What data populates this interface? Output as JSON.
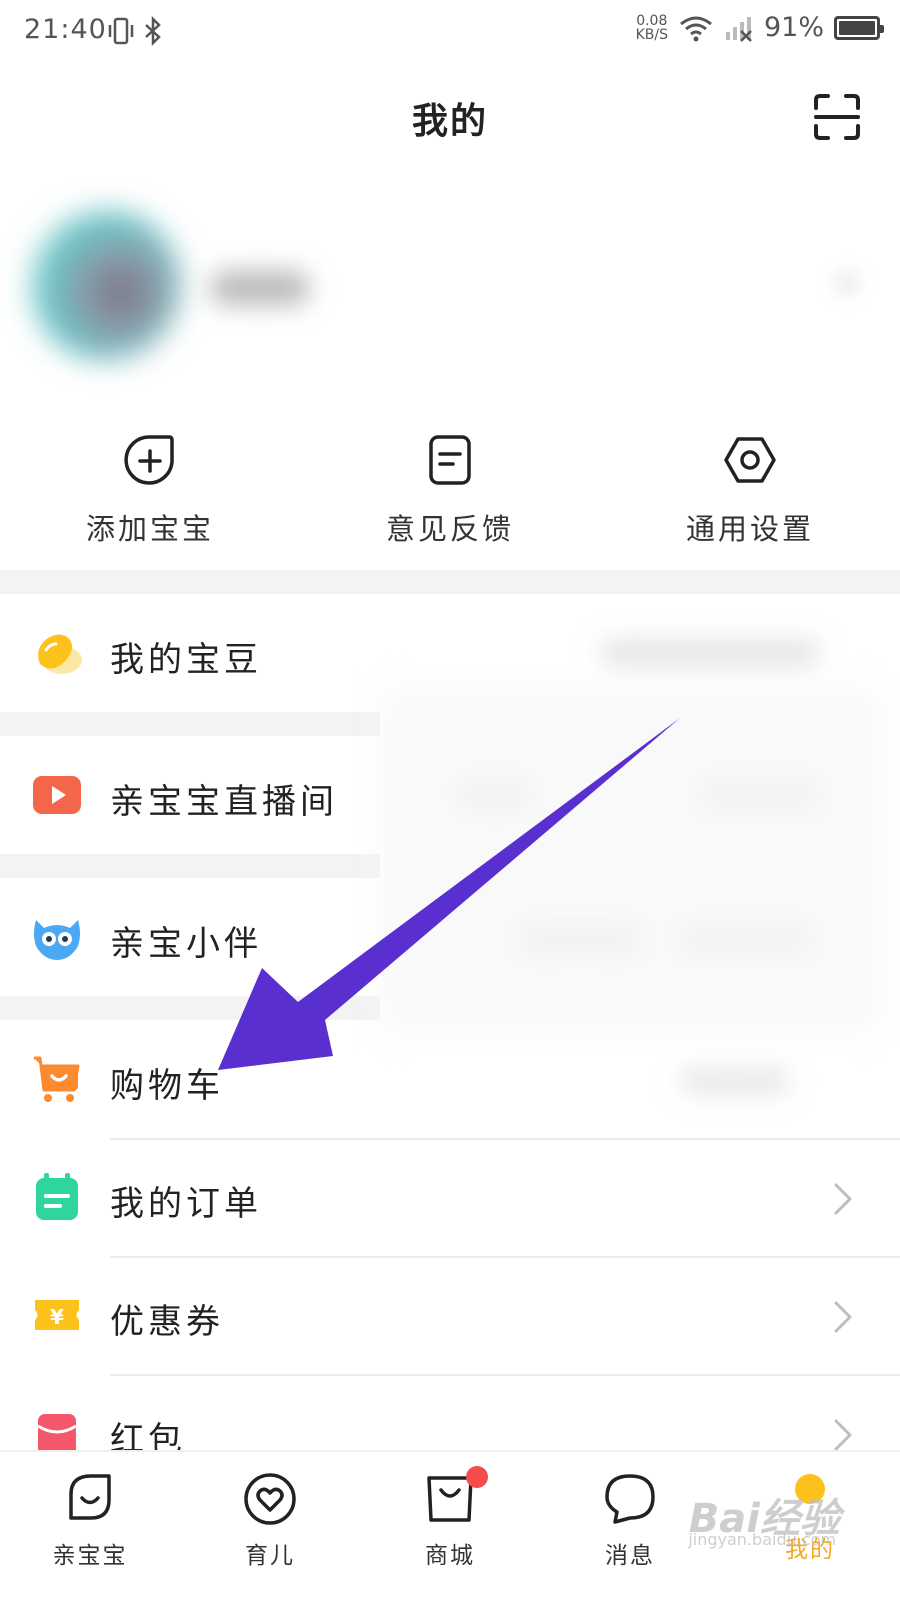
{
  "status_bar": {
    "time": "21:40",
    "net_speed_value": "0.08",
    "net_speed_unit": "KB/S",
    "battery": "91%"
  },
  "header": {
    "title": "我的",
    "scan_icon": "scan-icon"
  },
  "quick_actions": [
    {
      "label": "添加宝宝",
      "icon": "add-baby-icon"
    },
    {
      "label": "意见反馈",
      "icon": "feedback-icon"
    },
    {
      "label": "通用设置",
      "icon": "settings-icon"
    }
  ],
  "menu": {
    "beans": {
      "label": "我的宝豆",
      "icon": "bean-icon"
    },
    "live": {
      "label": "亲宝宝直播间",
      "icon": "live-icon"
    },
    "companion": {
      "label": "亲宝小伴",
      "icon": "owl-icon"
    },
    "cart": {
      "label": "购物车",
      "icon": "cart-icon"
    },
    "orders": {
      "label": "我的订单",
      "icon": "order-icon"
    },
    "coupons": {
      "label": "优惠券",
      "icon": "coupon-icon"
    },
    "redpacket": {
      "label": "红包",
      "icon": "red-packet-icon"
    }
  },
  "bottom_nav": [
    {
      "label": "亲宝宝",
      "icon": "home-leaf-icon",
      "active": false
    },
    {
      "label": "育儿",
      "icon": "parenting-heart-icon",
      "active": false
    },
    {
      "label": "商城",
      "icon": "shop-bag-icon",
      "active": false
    },
    {
      "label": "消息",
      "icon": "message-icon",
      "active": false
    },
    {
      "label": "我的",
      "icon": "me-icon",
      "active": true
    }
  ],
  "colors": {
    "accent_yellow": "#fcc21b",
    "active_label": "#f5a623",
    "arrow_annotation": "#5a2fd0",
    "badge_red": "#f44b4b"
  },
  "watermark": {
    "text": "Bai经验",
    "sub": "jingyan.baidu.com"
  }
}
